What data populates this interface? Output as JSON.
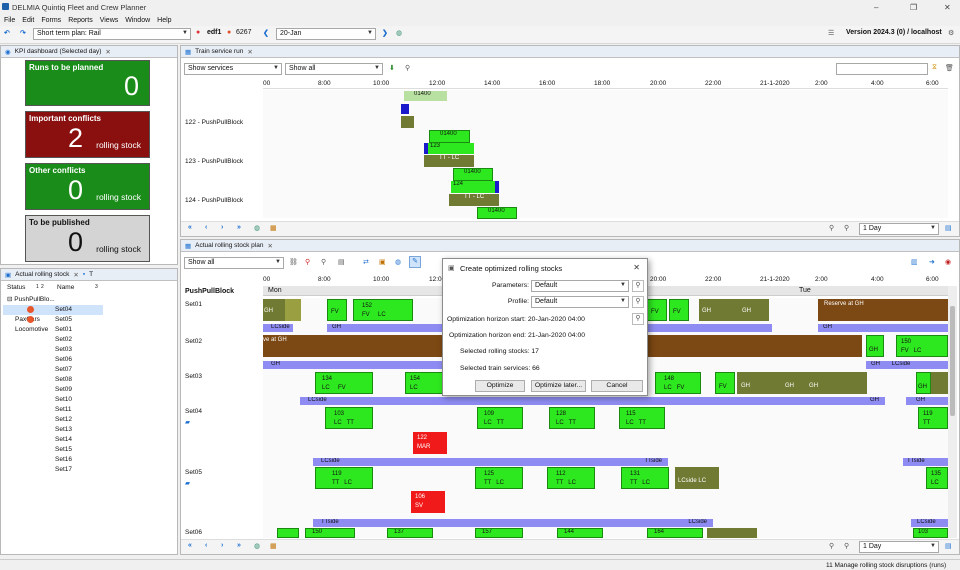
{
  "window": {
    "title": "DELMIA Quintiq Fleet and Crew Planner",
    "minimize": "–",
    "restore": "❐",
    "close": "✕"
  },
  "menu": [
    "File",
    "Edit",
    "Forms",
    "Reports",
    "Views",
    "Window",
    "Help"
  ],
  "toolbar": {
    "plan_label": "Short term plan: Rail",
    "user": "edf1",
    "count": "6267",
    "date": "20-Jan",
    "version": "Version 2024.3 (0) / localhost"
  },
  "kpi_panel": {
    "tab": "KPI dashboard (Selected day)",
    "cards": [
      {
        "label": "Runs to be planned",
        "value": "0",
        "sub": "",
        "color": "#1e8c1e"
      },
      {
        "label": "Important conflicts",
        "value": "2",
        "sub": "rolling stock",
        "color": "#8a1010"
      },
      {
        "label": "Other conflicts",
        "value": "0",
        "sub": "rolling stock",
        "color": "#1e8c1e"
      },
      {
        "label": "To be published",
        "value": "0",
        "sub": "rolling stock",
        "color": "#d4d4d4"
      }
    ]
  },
  "stock_panel": {
    "tab": "Actual rolling stock",
    "tab2": "T",
    "col_status": "Status",
    "col_sort1": "1",
    "col_sort2": "2",
    "col_name": "Name",
    "col_sort3": "3",
    "root": "PushPullBlo...",
    "sets": [
      "Set04",
      "Set05",
      "Set01",
      "Set02",
      "Set03",
      "Set06",
      "Set07",
      "Set08",
      "Set09",
      "Set10",
      "Set11",
      "Set12",
      "Set13",
      "Set14",
      "Set15",
      "Set16",
      "Set17"
    ],
    "others": [
      "PaxCars",
      "Locomotive"
    ]
  },
  "service_run": {
    "tab": "Train service run",
    "filter1": "Show services",
    "filter2": "Show all",
    "zoom": "1 Day",
    "times": [
      "00",
      "8:00",
      "10:00",
      "12:00",
      "14:00",
      "16:00",
      "18:00",
      "20:00",
      "22:00",
      "21-1-2020",
      "2:00",
      "4:00",
      "6:00"
    ],
    "rows": [
      "122 - PushPullBlock",
      "123 - PushPullBlock",
      "124 - PushPullBlock"
    ],
    "blocks": {
      "run": "01400",
      "run_blue": "123",
      "run_blue2": "124",
      "tt_lc": "TT - LC"
    }
  },
  "rolling_plan": {
    "tab": "Actual rolling stock plan",
    "filter": "Show all",
    "zoom": "1 Day",
    "times": [
      "00",
      "8:00",
      "10:00",
      "12:00",
      "14:00",
      "16:00",
      "18:00",
      "20:00",
      "22:00",
      "21-1-2020",
      "2:00",
      "4:00",
      "6:00"
    ],
    "group": "PushPullBlock",
    "day1": "Mon",
    "day2": "Tue",
    "rows": [
      "Set01",
      "Set02",
      "Set03",
      "Set04",
      "Set05",
      "Set06"
    ],
    "blocks": {
      "gh": "GH",
      "lc": "LC",
      "fv": "FV",
      "tt": "TT",
      "mar": "MAR",
      "sv": "SV",
      "lcside": "LCside",
      "ttside": "TTside",
      "ve_gh": "ve at GH",
      "reserve_gh": "Reserve at GH",
      "n152": "152",
      "n150": "150",
      "n134": "134",
      "n154": "154",
      "n148": "148",
      "n103": "103",
      "n109": "109",
      "n128": "128",
      "n115": "115",
      "n119": "119",
      "n122": "122",
      "n125": "125",
      "n112": "112",
      "n131": "131",
      "n135": "135",
      "n106": "106",
      "n137": "137",
      "n157": "157",
      "n144": "144",
      "n164": "164"
    }
  },
  "dialog": {
    "title": "Create optimized rolling stocks",
    "parameters_label": "Parameters:",
    "parameters_value": "Default",
    "profile_label": "Profile:",
    "profile_value": "Default",
    "start": "Optimization horizon start: 20-Jan-2020 04:00",
    "end": "Optimization horizon end: 21-Jan-2020 04:00",
    "sel_stocks": "Selected rolling stocks: 17",
    "sel_services": "Selected train services: 66",
    "optimize": "Optimize",
    "optimize_later": "Optimize later...",
    "cancel": "Cancel"
  },
  "status": {
    "text": "11 Manage rolling stock disruptions (runs)"
  }
}
